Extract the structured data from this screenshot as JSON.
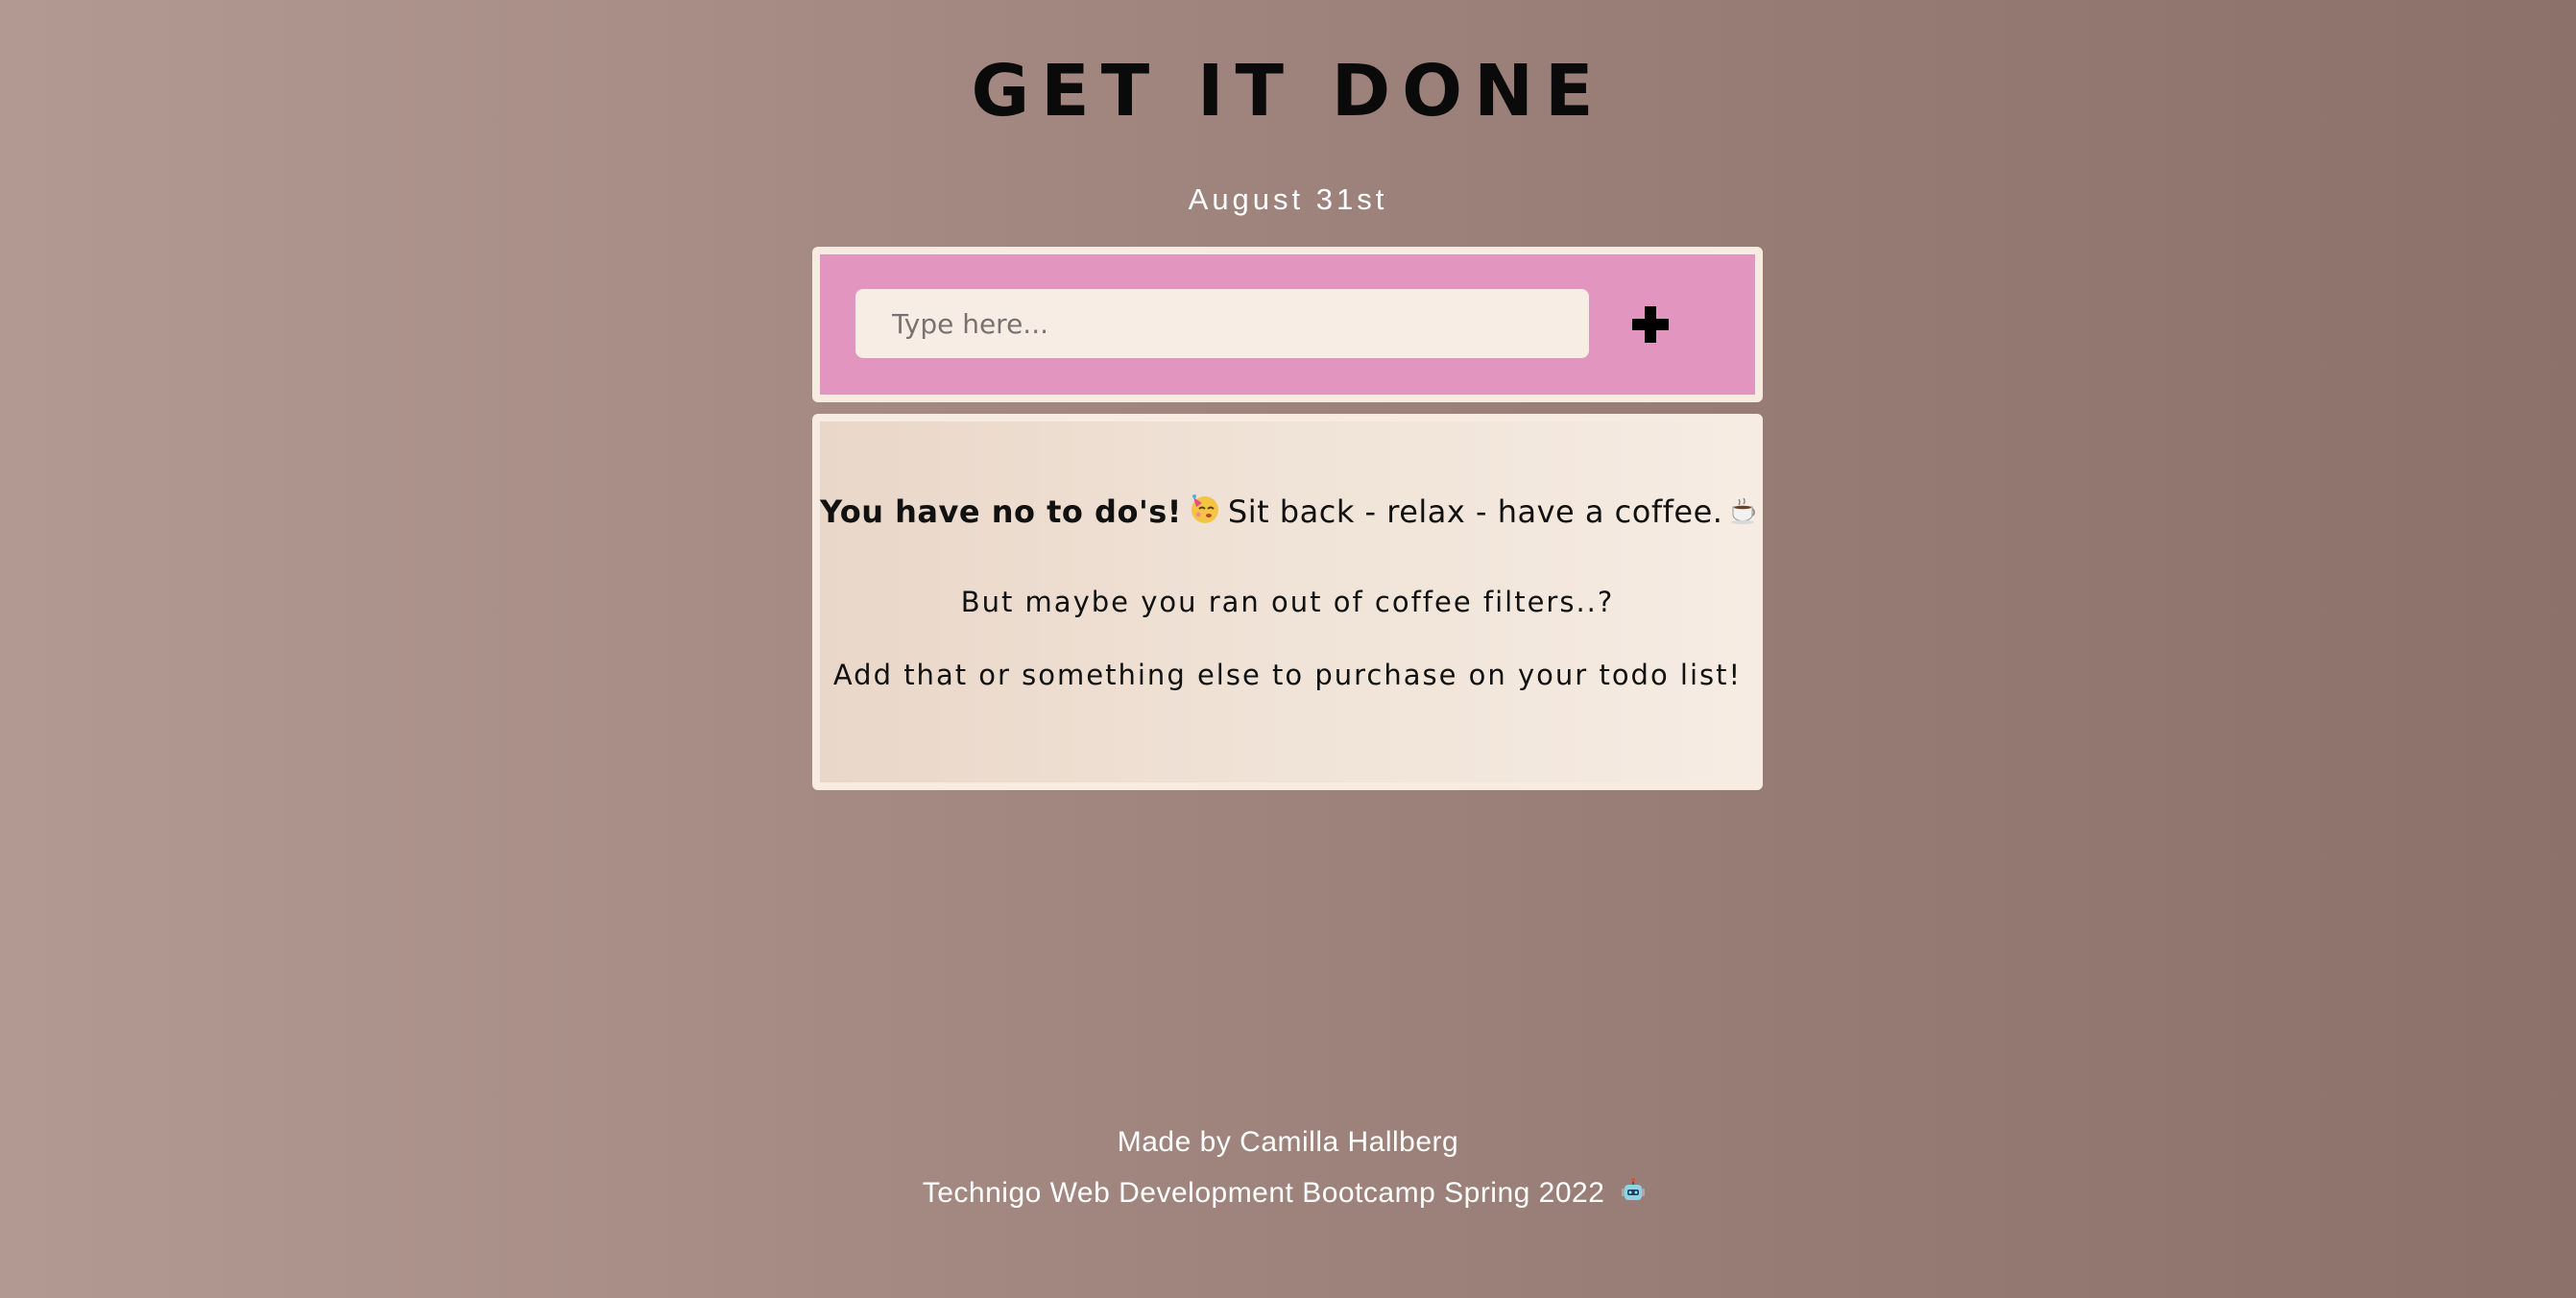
{
  "header": {
    "title": "GET IT DONE",
    "date": "August 31st"
  },
  "add_form": {
    "placeholder": "Type here...",
    "add_icon": "plus-icon"
  },
  "empty_state": {
    "headline_bold": "You have no to do's!",
    "headline_rest": "Sit back - relax - have a coffee.",
    "line2": "But maybe you ran out of coffee filters..?",
    "line3": "Add that or something else to purchase on your todo list!",
    "icons": [
      "partying-face-icon",
      "coffee-cup-icon"
    ]
  },
  "footer": {
    "author": "Made by Camilla Hallberg",
    "bootcamp": "Technigo Web Development Bootcamp Spring 2022",
    "bootcamp_icon": "robot-icon"
  },
  "colors": {
    "add_panel": "#e195bf",
    "panel_border": "#f7ebe2",
    "input_bg": "#f7ede4",
    "background_left": "#b29a92",
    "background_right": "#8c716a"
  }
}
